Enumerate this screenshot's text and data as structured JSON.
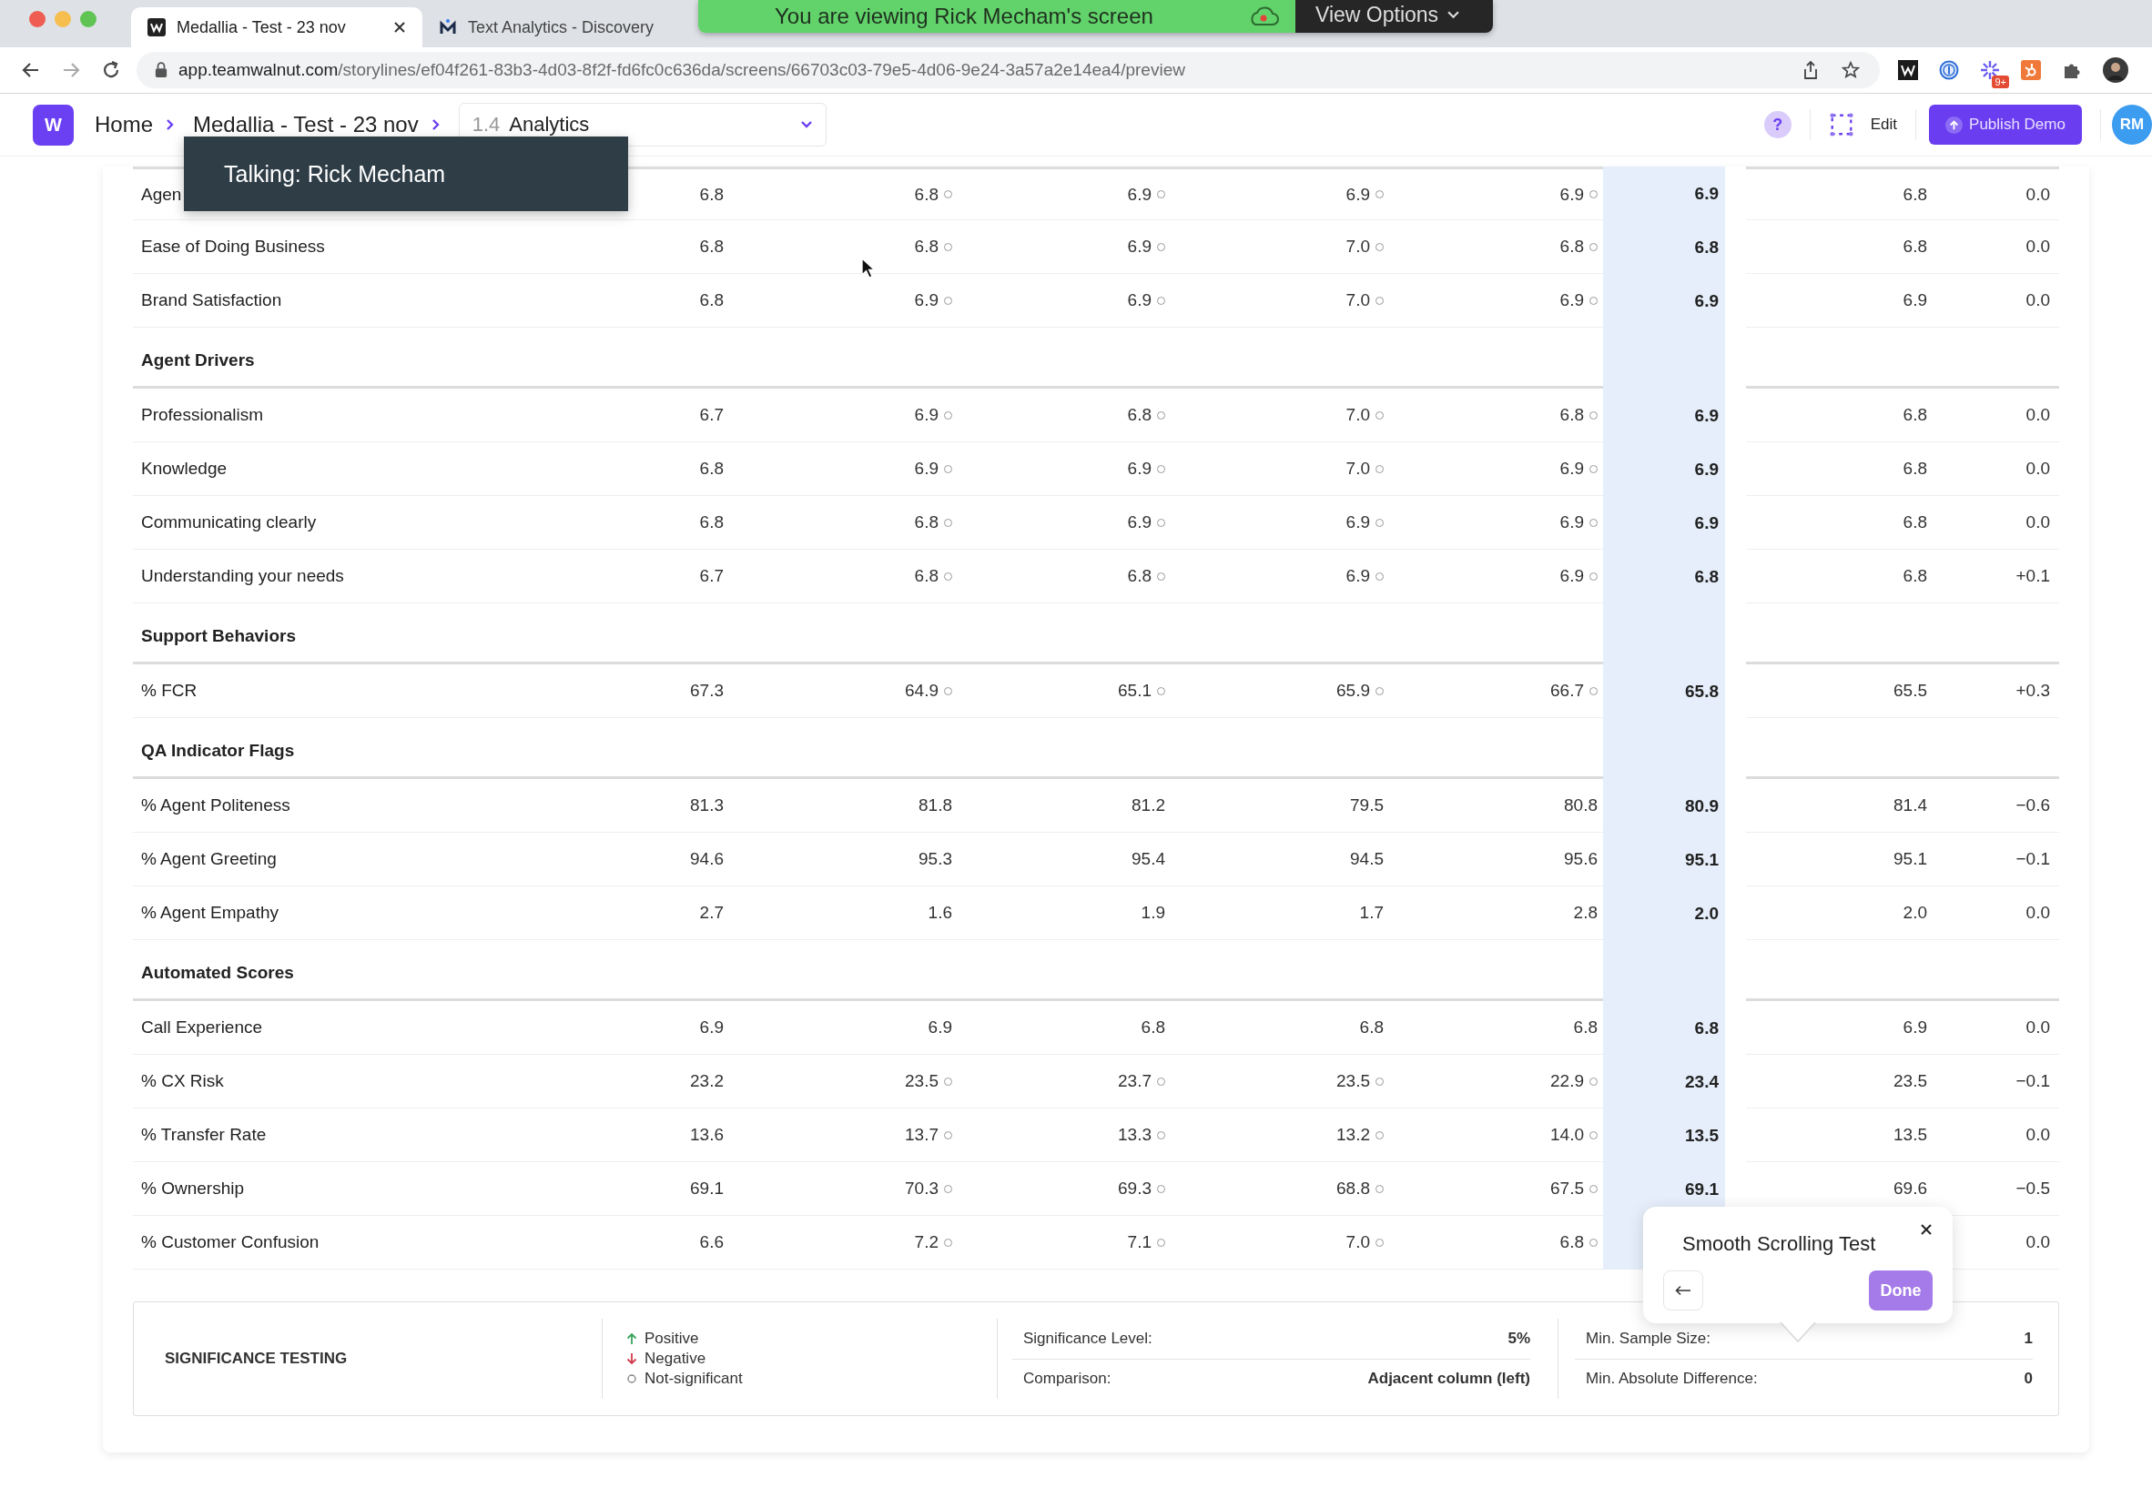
{
  "browser": {
    "tabs": [
      {
        "title": "Medallia - Test - 23 nov",
        "kind": "wlogo",
        "selected": true
      },
      {
        "title": "Text Analytics - Discovery",
        "kind": "mlogo",
        "selected": false
      }
    ],
    "url_host": "app.teamwalnut.com",
    "url_path": "/storylines/ef04f261-83b3-4d03-8f2f-fd6fc0c636da/screens/66703c03-79e5-4d06-9e24-3a57a2e14ea4/preview",
    "extension_badge": "9+"
  },
  "share_banner": {
    "message": "You are viewing Rick Mecham's screen",
    "options": "View Options"
  },
  "app_header": {
    "logo": "W",
    "breadcrumbs": [
      "Home",
      "Medallia - Test - 23 nov"
    ],
    "screen_number": "1.4",
    "screen_name": "Analytics",
    "help": "?",
    "edit": "Edit",
    "publish": "Publish Demo",
    "avatar": "RM"
  },
  "speaker_tooltip": "Talking: Rick Mecham",
  "table": {
    "rows": [
      {
        "kind": "metric",
        "label": "Agen",
        "values": [
          "6.8",
          "6.8",
          "6.9",
          "6.9",
          "6.9"
        ],
        "not_significant": [
          false,
          true,
          true,
          true,
          true
        ],
        "highlight": "6.9",
        "total": "6.8",
        "diff": "0.0"
      },
      {
        "kind": "metric",
        "label": "Ease of Doing Business",
        "values": [
          "6.8",
          "6.8",
          "6.9",
          "7.0",
          "6.8"
        ],
        "not_significant": [
          false,
          true,
          true,
          true,
          true
        ],
        "highlight": "6.8",
        "total": "6.8",
        "diff": "0.0"
      },
      {
        "kind": "metric",
        "label": "Brand Satisfaction",
        "values": [
          "6.8",
          "6.9",
          "6.9",
          "7.0",
          "6.9"
        ],
        "not_significant": [
          false,
          true,
          true,
          true,
          true
        ],
        "highlight": "6.9",
        "total": "6.9",
        "diff": "0.0"
      },
      {
        "kind": "section",
        "label": "Agent Drivers"
      },
      {
        "kind": "metric",
        "label": "Professionalism",
        "values": [
          "6.7",
          "6.9",
          "6.8",
          "7.0",
          "6.8"
        ],
        "not_significant": [
          false,
          true,
          true,
          true,
          true
        ],
        "highlight": "6.9",
        "total": "6.8",
        "diff": "0.0"
      },
      {
        "kind": "metric",
        "label": "Knowledge",
        "values": [
          "6.8",
          "6.9",
          "6.9",
          "7.0",
          "6.9"
        ],
        "not_significant": [
          false,
          true,
          true,
          true,
          true
        ],
        "highlight": "6.9",
        "total": "6.8",
        "diff": "0.0"
      },
      {
        "kind": "metric",
        "label": "Communicating clearly",
        "values": [
          "6.8",
          "6.8",
          "6.9",
          "6.9",
          "6.9"
        ],
        "not_significant": [
          false,
          true,
          true,
          true,
          true
        ],
        "highlight": "6.9",
        "total": "6.8",
        "diff": "0.0"
      },
      {
        "kind": "metric",
        "label": "Understanding your needs",
        "values": [
          "6.7",
          "6.8",
          "6.8",
          "6.9",
          "6.9"
        ],
        "not_significant": [
          false,
          true,
          true,
          true,
          true
        ],
        "highlight": "6.8",
        "total": "6.8",
        "diff": "+0.1"
      },
      {
        "kind": "section",
        "label": "Support Behaviors"
      },
      {
        "kind": "metric",
        "label": "% FCR",
        "values": [
          "67.3",
          "64.9",
          "65.1",
          "65.9",
          "66.7"
        ],
        "not_significant": [
          false,
          true,
          true,
          true,
          true
        ],
        "highlight": "65.8",
        "total": "65.5",
        "diff": "+0.3"
      },
      {
        "kind": "section",
        "label": "QA Indicator Flags"
      },
      {
        "kind": "metric",
        "label": "% Agent Politeness",
        "values": [
          "81.3",
          "81.8",
          "81.2",
          "79.5",
          "80.8"
        ],
        "not_significant": [
          false,
          false,
          false,
          false,
          false
        ],
        "highlight": "80.9",
        "total": "81.4",
        "diff": "−0.6"
      },
      {
        "kind": "metric",
        "label": "% Agent Greeting",
        "values": [
          "94.6",
          "95.3",
          "95.4",
          "94.5",
          "95.6"
        ],
        "not_significant": [
          false,
          false,
          false,
          false,
          false
        ],
        "highlight": "95.1",
        "total": "95.1",
        "diff": "−0.1"
      },
      {
        "kind": "metric",
        "label": "% Agent Empathy",
        "values": [
          "2.7",
          "1.6",
          "1.9",
          "1.7",
          "2.8"
        ],
        "not_significant": [
          false,
          false,
          false,
          false,
          false
        ],
        "highlight": "2.0",
        "total": "2.0",
        "diff": "0.0"
      },
      {
        "kind": "section",
        "label": "Automated Scores"
      },
      {
        "kind": "metric",
        "label": "Call Experience",
        "values": [
          "6.9",
          "6.9",
          "6.8",
          "6.8",
          "6.8"
        ],
        "not_significant": [
          false,
          false,
          false,
          false,
          false
        ],
        "highlight": "6.8",
        "total": "6.9",
        "diff": "0.0"
      },
      {
        "kind": "metric",
        "label": "% CX Risk",
        "values": [
          "23.2",
          "23.5",
          "23.7",
          "23.5",
          "22.9"
        ],
        "not_significant": [
          false,
          true,
          true,
          true,
          true
        ],
        "highlight": "23.4",
        "total": "23.5",
        "diff": "−0.1"
      },
      {
        "kind": "metric",
        "label": "% Transfer Rate",
        "values": [
          "13.6",
          "13.7",
          "13.3",
          "13.2",
          "14.0"
        ],
        "not_significant": [
          false,
          true,
          true,
          true,
          true
        ],
        "highlight": "13.5",
        "total": "13.5",
        "diff": "0.0"
      },
      {
        "kind": "metric",
        "label": "% Ownership",
        "values": [
          "69.1",
          "70.3",
          "69.3",
          "68.8",
          "67.5"
        ],
        "not_significant": [
          false,
          true,
          true,
          true,
          true
        ],
        "highlight": "69.1",
        "total": "69.6",
        "diff": "−0.5"
      },
      {
        "kind": "metric",
        "label": "% Customer Confusion",
        "values": [
          "6.6",
          "7.2",
          "7.1",
          "7.0",
          "6.8"
        ],
        "not_significant": [
          false,
          true,
          true,
          true,
          true
        ],
        "diff": "0.0"
      }
    ]
  },
  "legend": {
    "title": "SIGNIFICANCE TESTING",
    "items": [
      {
        "kind": "positive",
        "label": "Positive"
      },
      {
        "kind": "negative",
        "label": "Negative"
      },
      {
        "kind": "not_significant",
        "label": "Not-significant"
      }
    ],
    "settings": [
      [
        {
          "label": "Significance Level:",
          "value": "5%"
        },
        {
          "label": "Comparison:",
          "value": "Adjacent column (left)"
        }
      ],
      [
        {
          "label": "Min. Sample Size:",
          "value": "1"
        },
        {
          "label": "Min. Absolute Difference:",
          "value": "0"
        }
      ]
    ]
  },
  "tour_popup": {
    "title": "Smooth Scrolling Test",
    "done": "Done"
  }
}
